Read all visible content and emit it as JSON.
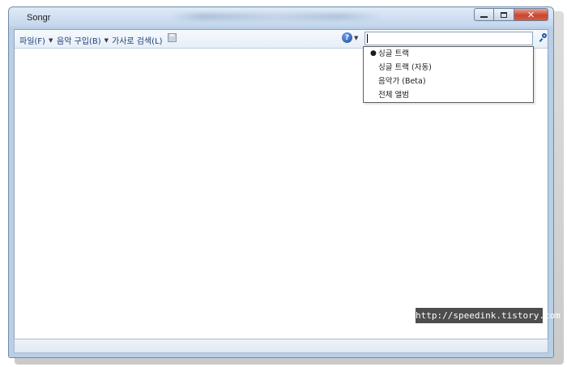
{
  "window": {
    "title": "Songr"
  },
  "menu": {
    "items": [
      {
        "label": "파일(F)",
        "has_dropdown": true
      },
      {
        "label": "음악 구입(B)",
        "has_dropdown": true
      },
      {
        "label": "가사로 검색(L)",
        "has_dropdown": false
      }
    ],
    "save_icon": "save-icon",
    "help_icon": "help-icon"
  },
  "search": {
    "value": "",
    "placeholder": "",
    "icon": "search-icon"
  },
  "search_modes": {
    "options": [
      {
        "label": "싱글 트랙",
        "selected": true
      },
      {
        "label": "싱글 트랙 (자동)",
        "selected": false
      },
      {
        "label": "음악가 (Beta)",
        "selected": false
      },
      {
        "label": "전체 앨범",
        "selected": false
      }
    ]
  },
  "watermark": {
    "text": "http://speedink.tistory.com"
  },
  "colors": {
    "menu_text": "#1e3f78",
    "titlebar": "#c3d6ec",
    "close_button": "#c9472f"
  }
}
